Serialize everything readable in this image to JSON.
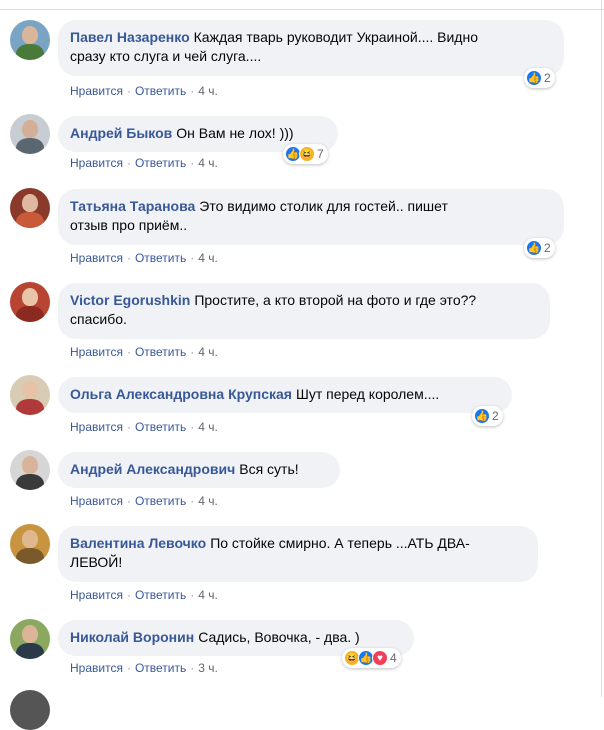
{
  "comments": [
    {
      "author": "Павел Назаренко",
      "text": "Каждая тварь руководит Украиной.... Видно",
      "text2": "сразу кто слуга и чей слуга....",
      "like": "Нравится",
      "reply": "Ответить",
      "time": "4 ч.",
      "count": "2",
      "avatar_color": "#5a8a4a"
    },
    {
      "author": "Андрей Быков",
      "text": "Он Вам не лох! )))",
      "like": "Нравится",
      "reply": "Ответить",
      "time": "4 ч.",
      "count": "7",
      "avatar_color": "#9aa7b0"
    },
    {
      "author": "Татьяна Таранова",
      "text": "Это видимо столик для гостей.. пишет",
      "text2": "отзыв про приём..",
      "like": "Нравится",
      "reply": "Ответить",
      "time": "4 ч.",
      "count": "2",
      "avatar_color": "#a04a3a"
    },
    {
      "author": "Victor Egorushkin",
      "text": "Простите, а кто второй на фото и где это??",
      "text2": "спасибо.",
      "like": "Нравится",
      "reply": "Ответить",
      "time": "4 ч.",
      "avatar_color": "#b04030"
    },
    {
      "author": "Ольга Александровна Крупская",
      "text": "Шут перед королем....",
      "like": "Нравится",
      "reply": "Ответить",
      "time": "4 ч.",
      "count": "2",
      "avatar_color": "#c9b89a"
    },
    {
      "author": "Андрей Александрович",
      "text": "Вся суть!",
      "like": "Нравится",
      "reply": "Ответить",
      "time": "4 ч.",
      "avatar_color": "#c8c8c8"
    },
    {
      "author": "Валентина Левочко",
      "text": "По стойке смирно. А теперь ...АТЬ ДВА-",
      "text2": "ЛЕВОЙ!",
      "like": "Нравится",
      "reply": "Ответить",
      "time": "4 ч.",
      "avatar_color": "#b07a2a"
    },
    {
      "author": "Николай Воронин",
      "text": "Садись, Вовочка, - два. )",
      "like": "Нравится",
      "reply": "Ответить",
      "time": "3 ч.",
      "count": "4",
      "avatar_color": "#6a8a3a"
    }
  ],
  "icons": {
    "like": "thumbs-up-icon",
    "haha": "haha-icon",
    "love": "heart-icon"
  },
  "colors": {
    "bubble": "#f0f2f5",
    "author": "#385898",
    "like": "#1877f2"
  }
}
